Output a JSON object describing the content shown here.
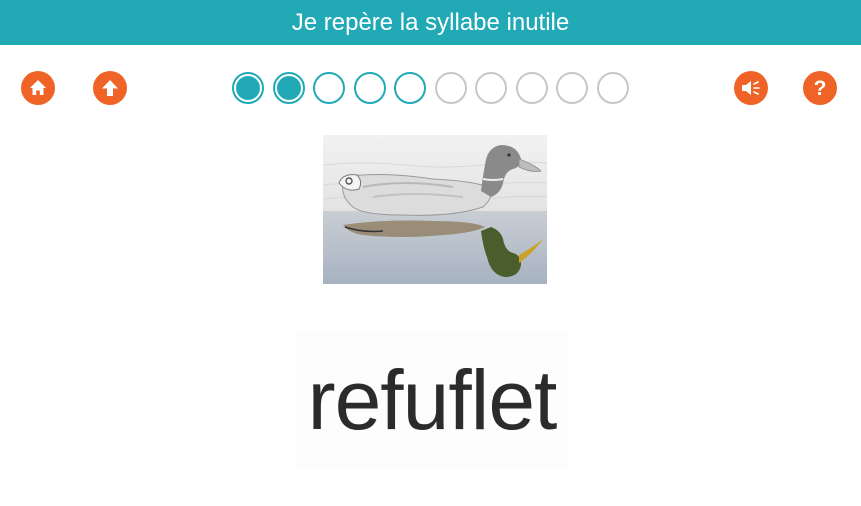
{
  "header": {
    "title": "Je repère la syllabe inutile"
  },
  "toolbar": {
    "home_icon": "home-icon",
    "up_icon": "arrow-up-icon",
    "sound_icon": "speaker-icon",
    "help_icon": "question-icon",
    "help_glyph": "?",
    "button_color": "#ef6326"
  },
  "progress": {
    "total": 10,
    "completed": 2,
    "current_highlighted": 3,
    "accent_color": "#22a9b6"
  },
  "picture": {
    "subject_icon": "duck-image"
  },
  "exercise": {
    "word": "refuflet"
  }
}
